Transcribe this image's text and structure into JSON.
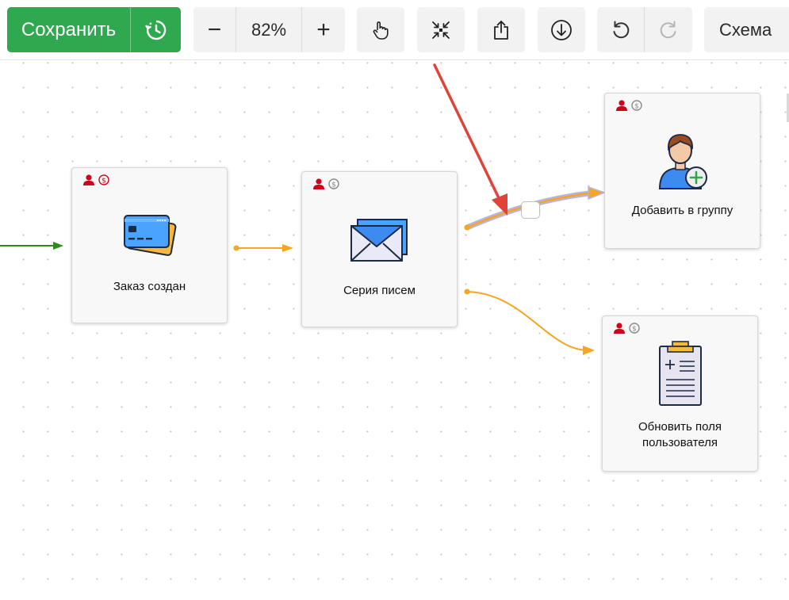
{
  "toolbar": {
    "save_label": "Сохранить",
    "zoom_minus": "−",
    "zoom_value": "82%",
    "zoom_plus": "+",
    "schema_label": "Схема"
  },
  "nodes": {
    "order_created": {
      "label": "Заказ создан"
    },
    "email_series": {
      "label": "Серия писем"
    },
    "add_to_group": {
      "label": "Добавить в группу"
    },
    "update_fields": {
      "label_line1": "Обновить поля",
      "label_line2": "пользователя"
    }
  },
  "colors": {
    "save_green": "#2fa84f",
    "edge_orange": "#f5a623",
    "edge_green": "#2e8b1e",
    "edge_highlight": "#b8b4e0",
    "annotation_red": "#e0433a",
    "badge_red": "#d0021b",
    "badge_gray": "#8a8a8a"
  },
  "icons": {
    "history": "history-icon",
    "pan": "hand-pointer-icon",
    "fit": "collapse-arrows-icon",
    "share": "share-upload-icon",
    "download": "download-circle-icon",
    "undo": "undo-icon",
    "redo": "redo-icon",
    "credit_card": "credit-cards-icon",
    "envelope": "envelope-icon",
    "add_user": "add-user-icon",
    "clipboard": "clipboard-icon",
    "person_badge": "person-icon",
    "coin_badge": "coin-icon"
  }
}
